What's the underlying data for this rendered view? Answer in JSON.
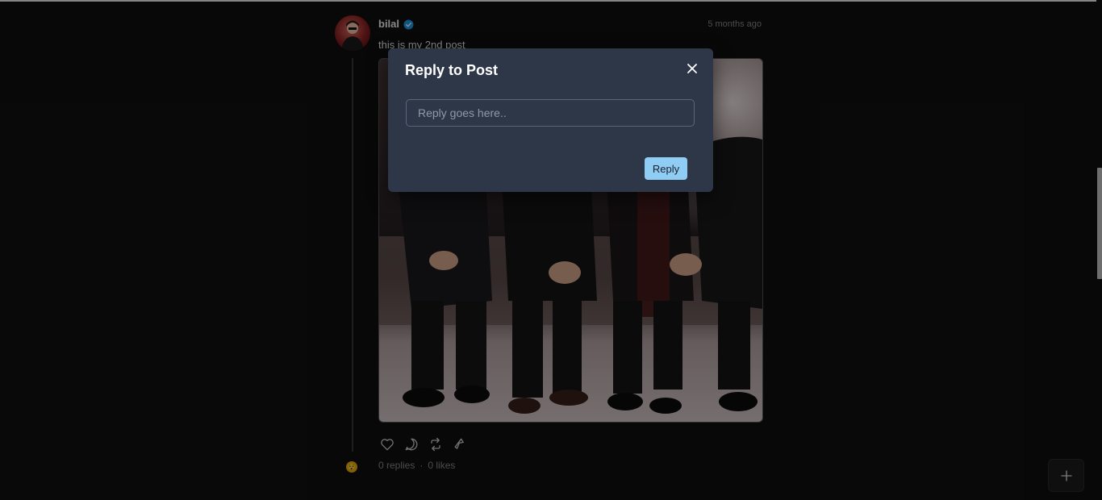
{
  "post": {
    "username": "bilal",
    "verified_icon": "verified-badge-icon",
    "timestamp": "5 months ago",
    "text": "this is my 2nd post",
    "replies": "0 replies",
    "separator": "·",
    "likes": "0 likes",
    "actions": [
      "heart-icon",
      "comment-icon",
      "repost-icon",
      "share-icon"
    ]
  },
  "modal": {
    "title": "Reply to Post",
    "input_placeholder": "Reply goes here..",
    "input_value": "",
    "submit_label": "Reply"
  },
  "colors": {
    "modal_bg": "#2d3748",
    "button_bg": "#90cdf4",
    "verified": "#1d9bf0"
  }
}
